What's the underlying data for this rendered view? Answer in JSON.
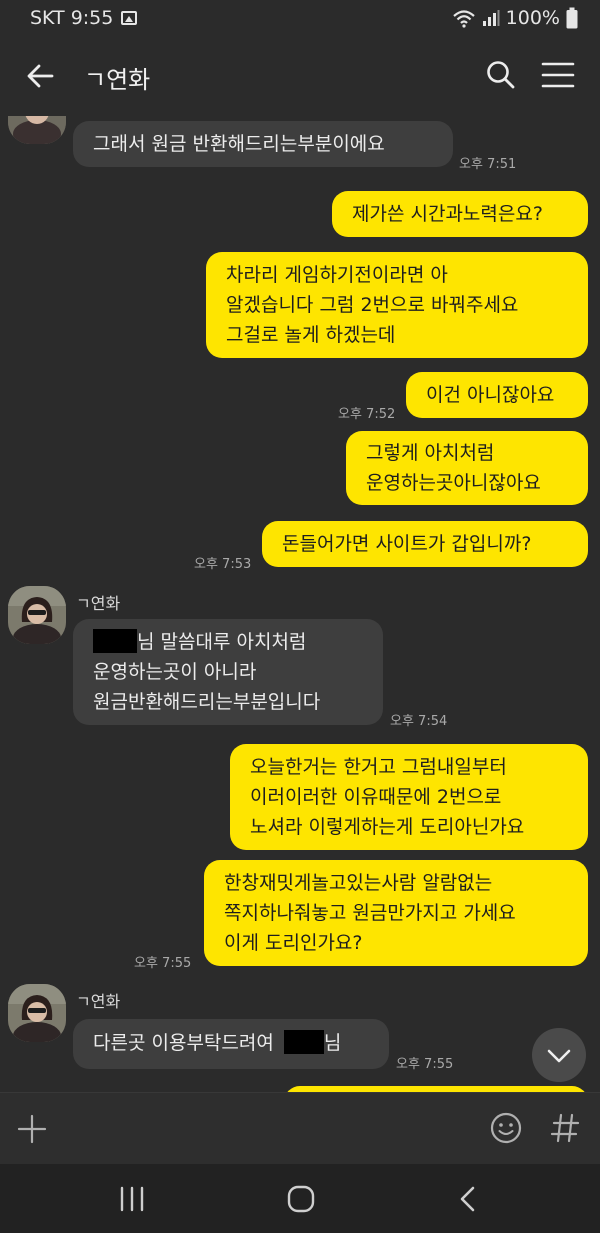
{
  "status": {
    "carrier_time": "SKT 9:55",
    "battery": "100%"
  },
  "header": {
    "title": "ㄱ연화"
  },
  "messages": [
    {
      "text": "그래서 원금 반환해드리는부분이에요",
      "time": "오후 7:51"
    },
    {
      "text": "제가쓴 시간과노력은요?"
    },
    {
      "text": "차라리 게임하기전이라면 아\n알겠습니다 그럼 2번으로 바꿔주세요\n그걸로 놀게 하겠는데"
    },
    {
      "text": "이건 아니잖아요",
      "time": "오후 7:52"
    },
    {
      "text": "그렇게 아치처럼\n운영하는곳아니잖아요"
    },
    {
      "text": "돈들어가면 사이트가 갑입니까?",
      "time": "오후 7:53"
    },
    {
      "sender": "ㄱ연화",
      "line1_suffix": "님 말씀대루 아치처럼",
      "line2": "운영하는곳이 아니라",
      "line3": "원금반환해드리는부분입니다",
      "time": "오후 7:54"
    },
    {
      "text": "오늘한거는 한거고 그럼내일부터\n이러이러한 이유때문에 2번으로\n노셔라 이렇게하는게 도리아닌가요"
    },
    {
      "text": "한창재밋게놀고있는사람 알람없는\n쪽지하나줘놓고 원금만가지고 가세요\n이게 도리인가요?",
      "time": "오후 7:55"
    },
    {
      "sender": "ㄱ연화",
      "prefix": "다른곳 이용부탁드려여",
      "suffix": "님",
      "time": "오후 7:55"
    }
  ]
}
